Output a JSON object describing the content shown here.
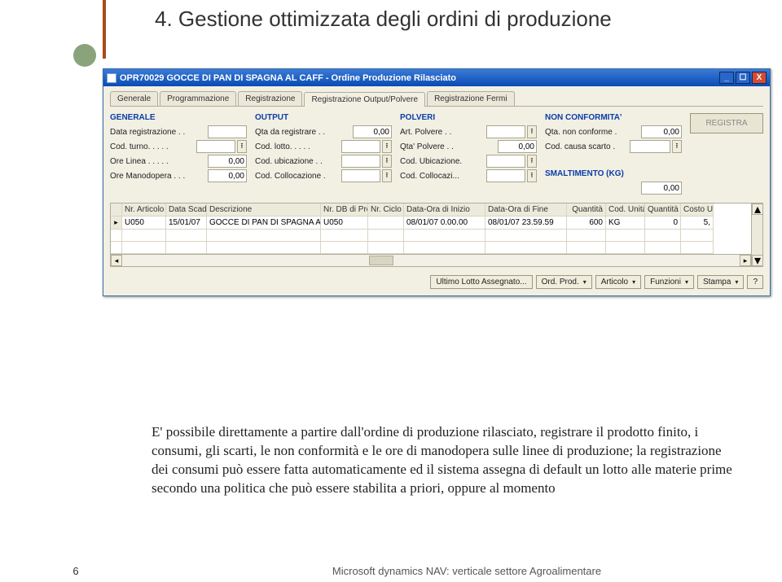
{
  "slide": {
    "title": "4. Gestione ottimizzata degli ordini di produzione",
    "body_text": "E' possibile direttamente a partire dall'ordine di produzione rilasciato, registrare il prodotto finito, i consumi, gli scarti, le non conformità e le ore di manodopera sulle linee di produzione; la registrazione dei consumi può essere fatta automaticamente ed il sistema assegna di default un lotto alle materie prime secondo una politica che può essere stabilita a priori, oppure al momento",
    "page_number": "6",
    "footer": "Microsoft dynamics NAV: verticale settore Agroalimentare"
  },
  "window": {
    "title": "OPR70029 GOCCE DI PAN DI SPAGNA AL CAFF - Ordine Produzione Rilasciato",
    "tabs": [
      "Generale",
      "Programmazione",
      "Registrazione",
      "Registrazione Output/Polvere",
      "Registrazione Fermi"
    ],
    "active_tab": 3,
    "groups": {
      "generale": {
        "title": "GENERALE",
        "data_registrazione_label": "Data registrazione . .",
        "data_registrazione": "",
        "cod_turno_label": "Cod. turno. . . . .",
        "cod_turno": "",
        "ore_linea_label": "Ore Linea . . . . .",
        "ore_linea": "0,00",
        "ore_manodopera_label": "Ore Manodopera . . .",
        "ore_manodopera": "0,00"
      },
      "output": {
        "title": "OUTPUT",
        "qta_da_registrare_label": "Qta da registrare . .",
        "qta_da_registrare": "0,00",
        "cod_lotto_label": "Cod. lotto. . . . .",
        "cod_lotto": "",
        "cod_ubicazione_label": "Cod. ubicazione . .",
        "cod_ubicazione": "",
        "cod_collocazione_label": "Cod. Collocazione .",
        "cod_collocazione": ""
      },
      "polveri": {
        "title": "POLVERI",
        "art_polvere_label": "Art. Polvere . .",
        "art_polvere": "",
        "qta_polvere_label": "Qta' Polvere . .",
        "qta_polvere": "0,00",
        "cod_ubicazione_label": "Cod. Ubicazione.",
        "cod_ubicazione": "",
        "cod_collocazi_label": "Cod. Collocazi...",
        "cod_collocazi": ""
      },
      "nonconf": {
        "title": "NON CONFORMITA'",
        "qta_non_conforme_label": "Qta. non conforme .",
        "qta_non_conforme": "0,00",
        "cod_causa_scarto_label": "Cod. causa scarto .",
        "cod_causa_scarto": ""
      },
      "smaltimento": {
        "title": "SMALTIMENTO (KG)",
        "value": "0,00"
      },
      "registra_btn": "REGISTRA"
    },
    "grid": {
      "headers": [
        "Nr. Articolo",
        "Data Scadenza",
        "Descrizione",
        "Nr. DB di Produzione",
        "Nr. Ciclo",
        "Data-Ora di Inizio",
        "Data-Ora di Fine",
        "Quantità",
        "Cod. Unità di Misura",
        "Quantità Residua",
        "Costo Unitario"
      ],
      "row": {
        "nr_articolo": "U050",
        "data_scadenza": "15/01/07",
        "descrizione": "GOCCE DI PAN DI SPAGNA AL ...",
        "nr_db": "U050",
        "nr_ciclo": "",
        "inizio": "08/01/07 0.00.00",
        "fine": "08/01/07 23.59.59",
        "quantita": "600",
        "um": "KG",
        "residua": "0",
        "costo": "5,"
      }
    },
    "footer_buttons": [
      "Ultimo Lotto Assegnato...",
      "Ord. Prod.",
      "Articolo",
      "Funzioni",
      "Stampa",
      "?"
    ]
  }
}
